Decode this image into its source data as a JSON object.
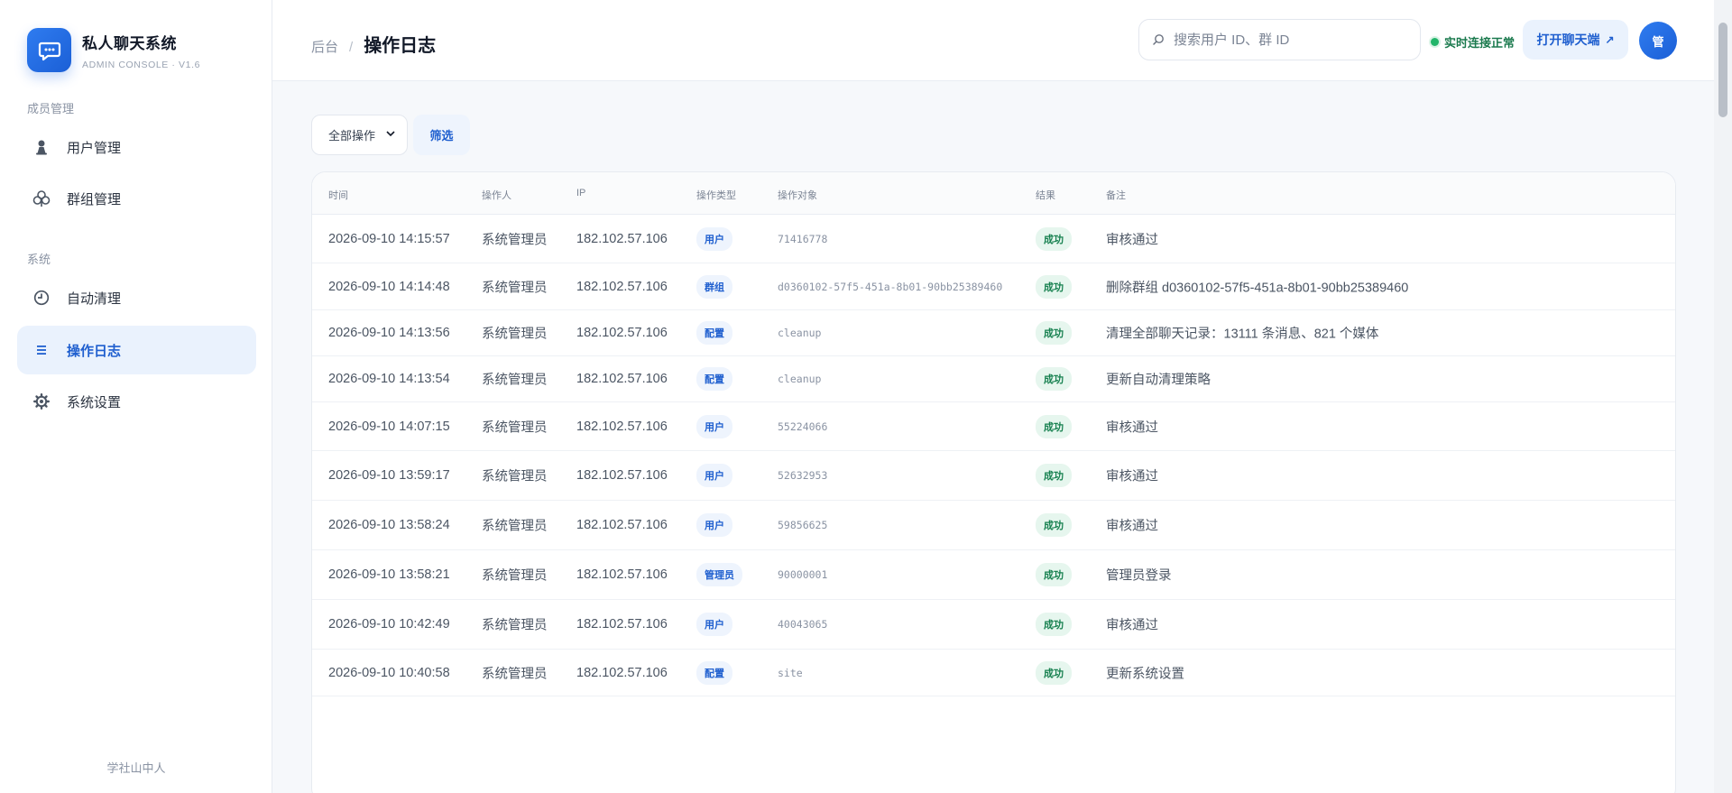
{
  "app": {
    "name": "私人聊天系统",
    "subtitle": "ADMIN CONSOLE · V1.6",
    "footer": "学社山中人"
  },
  "sidebar": {
    "sections": [
      {
        "label": "成员管理"
      },
      {
        "label": "系统"
      }
    ],
    "items": [
      {
        "label": "用户管理",
        "icon": "user-icon"
      },
      {
        "label": "群组管理",
        "icon": "group-icon"
      },
      {
        "label": "自动清理",
        "icon": "clock-icon"
      },
      {
        "label": "操作日志",
        "icon": "list-icon",
        "active": true
      },
      {
        "label": "系统设置",
        "icon": "gear-icon"
      }
    ]
  },
  "header": {
    "breadcrumb_parent": "后台",
    "breadcrumb_sep": "/",
    "title": "操作日志",
    "search_placeholder": "搜索用户 ID、群 ID",
    "status_text": "实时连接正常",
    "open_label": "打开聊天端",
    "open_arrow": "↗",
    "avatar_text": "管"
  },
  "filter": {
    "selected": "全部操作",
    "options": [
      "全部操作"
    ],
    "button_label": "筛选"
  },
  "table": {
    "columns": [
      "时间",
      "操作人",
      "IP",
      "操作类型",
      "操作对象",
      "结果",
      "备注"
    ],
    "rows": [
      {
        "time": "2026-09-10 14:15:57",
        "operator": "系统管理员",
        "ip": "182.102.57.106",
        "type": "用户",
        "target": " 71416778",
        "result": "成功",
        "note": "审核通过"
      },
      {
        "time": "2026-09-10 14:14:48",
        "operator": "系统管理员",
        "ip": "182.102.57.106",
        "type": "群组",
        "target": "d0360102-57f5-451a-8b01-90bb25389460",
        "result": "成功",
        "note": "删除群组 d0360102-57f5-451a-8b01-90bb25389460"
      },
      {
        "time": "2026-09-10 14:13:56",
        "operator": "系统管理员",
        "ip": "182.102.57.106",
        "type": "配置",
        "target": "cleanup",
        "result": "成功",
        "note": "清理全部聊天记录：13111 条消息、821 个媒体"
      },
      {
        "time": "2026-09-10 14:13:54",
        "operator": "系统管理员",
        "ip": "182.102.57.106",
        "type": "配置",
        "target": "cleanup",
        "result": "成功",
        "note": "更新自动清理策略"
      },
      {
        "time": "2026-09-10 14:07:15",
        "operator": "系统管理员",
        "ip": "182.102.57.106",
        "type": "用户",
        "target": " 55224066",
        "result": "成功",
        "note": "审核通过"
      },
      {
        "time": "2026-09-10 13:59:17",
        "operator": "系统管理员",
        "ip": "182.102.57.106",
        "type": "用户",
        "target": " 52632953",
        "result": "成功",
        "note": "审核通过"
      },
      {
        "time": "2026-09-10 13:58:24",
        "operator": "系统管理员",
        "ip": "182.102.57.106",
        "type": "用户",
        "target": " 59856625",
        "result": "成功",
        "note": "审核通过"
      },
      {
        "time": "2026-09-10 13:58:21",
        "operator": "系统管理员",
        "ip": "182.102.57.106",
        "type": "管理员",
        "target": " 90000001",
        "result": "成功",
        "note": "管理员登录"
      },
      {
        "time": "2026-09-10 10:42:49",
        "operator": "系统管理员",
        "ip": "182.102.57.106",
        "type": "用户",
        "target": " 40043065",
        "result": "成功",
        "note": "审核通过"
      },
      {
        "time": "2026-09-10 10:40:58",
        "operator": "系统管理员",
        "ip": "182.102.57.106",
        "type": "配置",
        "target": "site",
        "result": "成功",
        "note": "更新系统设置"
      }
    ]
  },
  "colors": {
    "accent": "#1f5fcf",
    "success": "#16804f",
    "status_dot": "#22b56a"
  }
}
